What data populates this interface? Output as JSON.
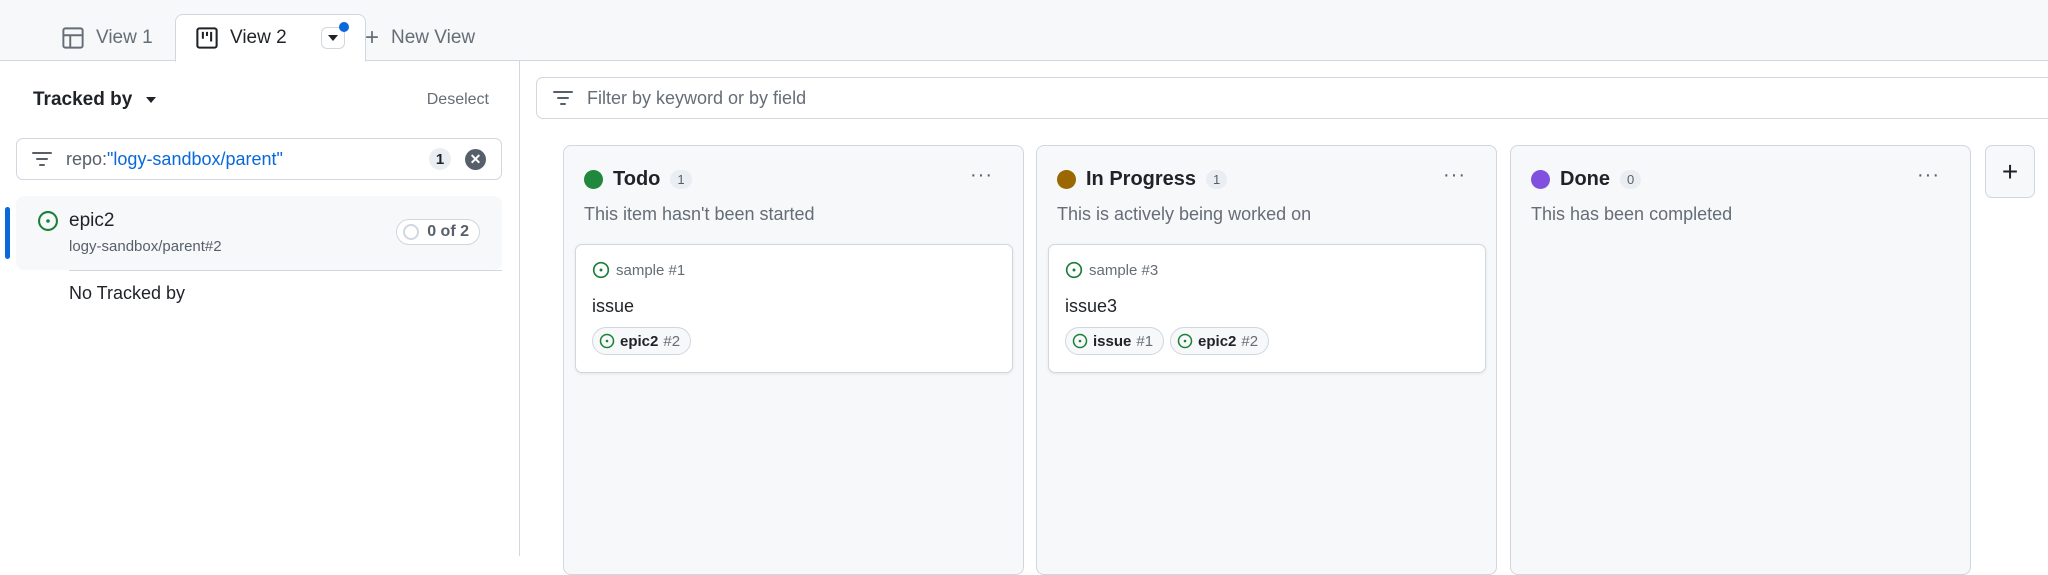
{
  "tabs": [
    {
      "label": "View 1",
      "icon": "table-icon"
    },
    {
      "label": "View 2",
      "icon": "board-icon",
      "active": true
    },
    {
      "label": "New View",
      "icon": "plus-icon"
    }
  ],
  "sidebar": {
    "title": "Tracked by",
    "deselect": "Deselect",
    "filter": {
      "prefix": "repo:",
      "value": "\"logy-sandbox/parent\"",
      "count": "1"
    },
    "selected": {
      "title": "epic2",
      "subtitle": "logy-sandbox/parent#2",
      "progress": "0 of 2"
    },
    "none_label": "No Tracked by"
  },
  "main": {
    "filter_placeholder": "Filter by keyword or by field",
    "columns": [
      {
        "name": "Todo",
        "count": "1",
        "color": "#1f883d",
        "description": "This item hasn't been started",
        "cards": [
          {
            "ref": "sample #1",
            "title": "issue",
            "chips": [
              {
                "name": "epic2",
                "num": "#2"
              }
            ]
          }
        ]
      },
      {
        "name": "In Progress",
        "count": "1",
        "color": "#9a6700",
        "description": "This is actively being worked on",
        "cards": [
          {
            "ref": "sample #3",
            "title": "issue3",
            "chips": [
              {
                "name": "issue",
                "num": "#1"
              },
              {
                "name": "epic2",
                "num": "#2"
              }
            ]
          }
        ]
      },
      {
        "name": "Done",
        "count": "0",
        "color": "#8250df",
        "description": "This has been completed",
        "cards": []
      }
    ]
  }
}
